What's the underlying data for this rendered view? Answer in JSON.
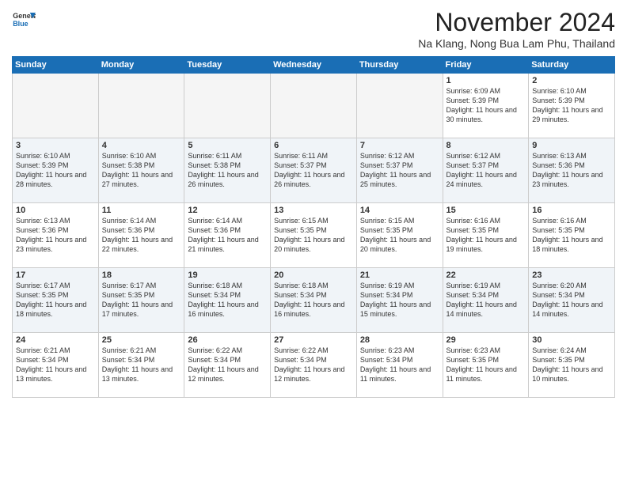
{
  "header": {
    "logo_line1": "General",
    "logo_line2": "Blue",
    "month_title": "November 2024",
    "location": "Na Klang, Nong Bua Lam Phu, Thailand"
  },
  "weekdays": [
    "Sunday",
    "Monday",
    "Tuesday",
    "Wednesday",
    "Thursday",
    "Friday",
    "Saturday"
  ],
  "weeks": [
    [
      {
        "day": "",
        "empty": true
      },
      {
        "day": "",
        "empty": true
      },
      {
        "day": "",
        "empty": true
      },
      {
        "day": "",
        "empty": true
      },
      {
        "day": "",
        "empty": true
      },
      {
        "day": "1",
        "sunrise": "6:09 AM",
        "sunset": "5:39 PM",
        "daylight": "11 hours and 30 minutes."
      },
      {
        "day": "2",
        "sunrise": "6:10 AM",
        "sunset": "5:39 PM",
        "daylight": "11 hours and 29 minutes."
      }
    ],
    [
      {
        "day": "3",
        "sunrise": "6:10 AM",
        "sunset": "5:39 PM",
        "daylight": "11 hours and 28 minutes."
      },
      {
        "day": "4",
        "sunrise": "6:10 AM",
        "sunset": "5:38 PM",
        "daylight": "11 hours and 27 minutes."
      },
      {
        "day": "5",
        "sunrise": "6:11 AM",
        "sunset": "5:38 PM",
        "daylight": "11 hours and 26 minutes."
      },
      {
        "day": "6",
        "sunrise": "6:11 AM",
        "sunset": "5:37 PM",
        "daylight": "11 hours and 26 minutes."
      },
      {
        "day": "7",
        "sunrise": "6:12 AM",
        "sunset": "5:37 PM",
        "daylight": "11 hours and 25 minutes."
      },
      {
        "day": "8",
        "sunrise": "6:12 AM",
        "sunset": "5:37 PM",
        "daylight": "11 hours and 24 minutes."
      },
      {
        "day": "9",
        "sunrise": "6:13 AM",
        "sunset": "5:36 PM",
        "daylight": "11 hours and 23 minutes."
      }
    ],
    [
      {
        "day": "10",
        "sunrise": "6:13 AM",
        "sunset": "5:36 PM",
        "daylight": "11 hours and 23 minutes."
      },
      {
        "day": "11",
        "sunrise": "6:14 AM",
        "sunset": "5:36 PM",
        "daylight": "11 hours and 22 minutes."
      },
      {
        "day": "12",
        "sunrise": "6:14 AM",
        "sunset": "5:36 PM",
        "daylight": "11 hours and 21 minutes."
      },
      {
        "day": "13",
        "sunrise": "6:15 AM",
        "sunset": "5:35 PM",
        "daylight": "11 hours and 20 minutes."
      },
      {
        "day": "14",
        "sunrise": "6:15 AM",
        "sunset": "5:35 PM",
        "daylight": "11 hours and 20 minutes."
      },
      {
        "day": "15",
        "sunrise": "6:16 AM",
        "sunset": "5:35 PM",
        "daylight": "11 hours and 19 minutes."
      },
      {
        "day": "16",
        "sunrise": "6:16 AM",
        "sunset": "5:35 PM",
        "daylight": "11 hours and 18 minutes."
      }
    ],
    [
      {
        "day": "17",
        "sunrise": "6:17 AM",
        "sunset": "5:35 PM",
        "daylight": "11 hours and 18 minutes."
      },
      {
        "day": "18",
        "sunrise": "6:17 AM",
        "sunset": "5:35 PM",
        "daylight": "11 hours and 17 minutes."
      },
      {
        "day": "19",
        "sunrise": "6:18 AM",
        "sunset": "5:34 PM",
        "daylight": "11 hours and 16 minutes."
      },
      {
        "day": "20",
        "sunrise": "6:18 AM",
        "sunset": "5:34 PM",
        "daylight": "11 hours and 16 minutes."
      },
      {
        "day": "21",
        "sunrise": "6:19 AM",
        "sunset": "5:34 PM",
        "daylight": "11 hours and 15 minutes."
      },
      {
        "day": "22",
        "sunrise": "6:19 AM",
        "sunset": "5:34 PM",
        "daylight": "11 hours and 14 minutes."
      },
      {
        "day": "23",
        "sunrise": "6:20 AM",
        "sunset": "5:34 PM",
        "daylight": "11 hours and 14 minutes."
      }
    ],
    [
      {
        "day": "24",
        "sunrise": "6:21 AM",
        "sunset": "5:34 PM",
        "daylight": "11 hours and 13 minutes."
      },
      {
        "day": "25",
        "sunrise": "6:21 AM",
        "sunset": "5:34 PM",
        "daylight": "11 hours and 13 minutes."
      },
      {
        "day": "26",
        "sunrise": "6:22 AM",
        "sunset": "5:34 PM",
        "daylight": "11 hours and 12 minutes."
      },
      {
        "day": "27",
        "sunrise": "6:22 AM",
        "sunset": "5:34 PM",
        "daylight": "11 hours and 12 minutes."
      },
      {
        "day": "28",
        "sunrise": "6:23 AM",
        "sunset": "5:34 PM",
        "daylight": "11 hours and 11 minutes."
      },
      {
        "day": "29",
        "sunrise": "6:23 AM",
        "sunset": "5:35 PM",
        "daylight": "11 hours and 11 minutes."
      },
      {
        "day": "30",
        "sunrise": "6:24 AM",
        "sunset": "5:35 PM",
        "daylight": "11 hours and 10 minutes."
      }
    ]
  ],
  "labels": {
    "sunrise": "Sunrise:",
    "sunset": "Sunset:",
    "daylight": "Daylight:"
  }
}
